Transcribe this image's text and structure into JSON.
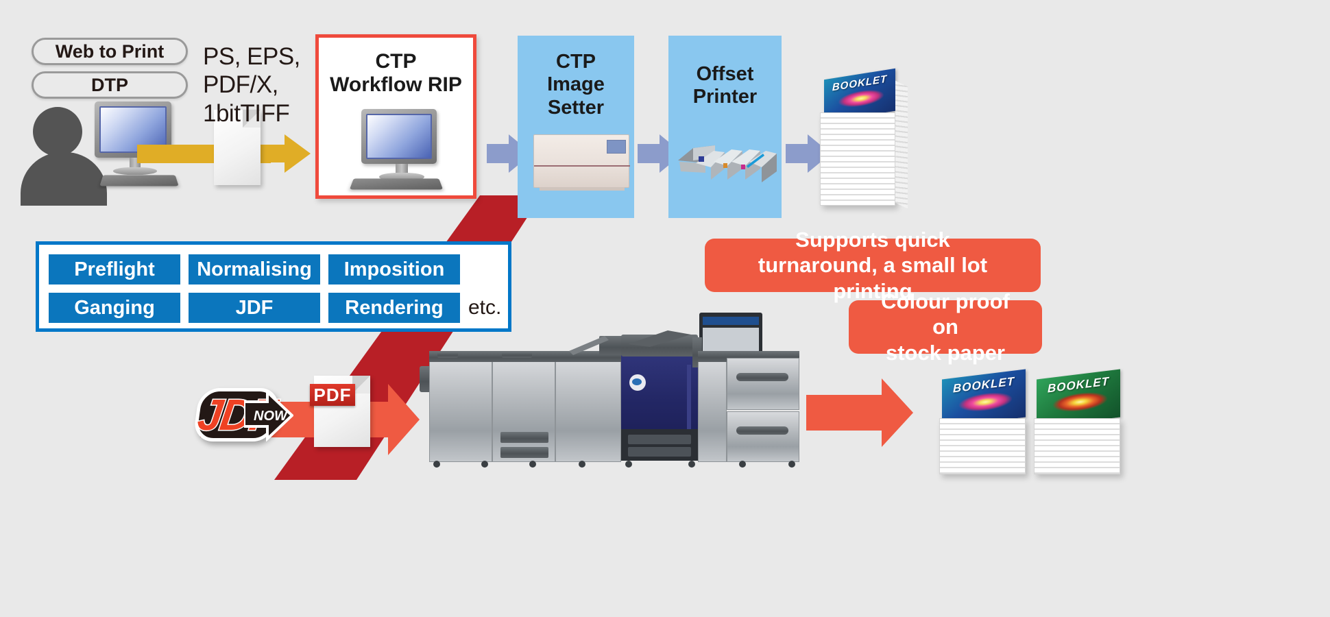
{
  "diagram": {
    "background_color": "#e9e9e9",
    "inputs": {
      "pills": [
        {
          "label": "Web to Print"
        },
        {
          "label": "DTP"
        }
      ],
      "operator_icon": "person-at-computer-icon",
      "formats_text": "PS, EPS,\nPDF/X,\n1bitTIFF",
      "formats_lines": [
        "PS, EPS,",
        "PDF/X,",
        "1bitTIFF"
      ],
      "document_icon": "document-sheet-icon"
    },
    "top_flow": {
      "rip_stage": {
        "title_lines": [
          "CTP",
          "Workflow RIP"
        ],
        "icon": "desktop-computer-icon",
        "border_color": "#ef4a3c"
      },
      "stages": [
        {
          "title_lines": [
            "CTP",
            "Image",
            "Setter"
          ],
          "icon": "imagesetter-machine-icon",
          "panel_color": "#89c7ef"
        },
        {
          "title_lines": [
            "Offset",
            "Printer"
          ],
          "icon": "offset-press-icon",
          "panel_color": "#89c7ef"
        }
      ],
      "output": {
        "label": "BOOKLET",
        "icon": "booklet-stack-icon"
      },
      "arrow_colors": {
        "input": "#e0ad26",
        "stage": "#8c9ccb"
      }
    },
    "features": {
      "border_color": "#0077c8",
      "button_color": "#0b76bd",
      "rows": [
        [
          "Preflight",
          "Normalising",
          "Imposition"
        ],
        [
          "Ganging",
          "JDF",
          "Rendering"
        ]
      ],
      "trailing_label": "etc."
    },
    "bottom_flow": {
      "jdf_logo": {
        "main": "JDF",
        "sub": "NOW",
        "icon": "jdf-now-logo-icon"
      },
      "pdf_file": {
        "badge": "PDF",
        "icon": "pdf-document-icon"
      },
      "press": {
        "icon": "digital-press-icon",
        "brand_mark": "konica-minolta-mark"
      },
      "outputs": [
        {
          "label": "BOOKLET",
          "cover": "blue",
          "icon": "booklet-stack-icon"
        },
        {
          "label": "BOOKLET",
          "cover": "green",
          "icon": "booklet-stack-icon"
        }
      ],
      "arrow_color": "#ef5a42",
      "band_color": "#b81f26"
    },
    "callouts": [
      {
        "lines": [
          "Supports quick",
          "turnaround, a small lot printing"
        ],
        "color": "#ef5a42"
      },
      {
        "lines": [
          "Colour proof on",
          "stock paper"
        ],
        "color": "#ef5a42"
      }
    ]
  }
}
